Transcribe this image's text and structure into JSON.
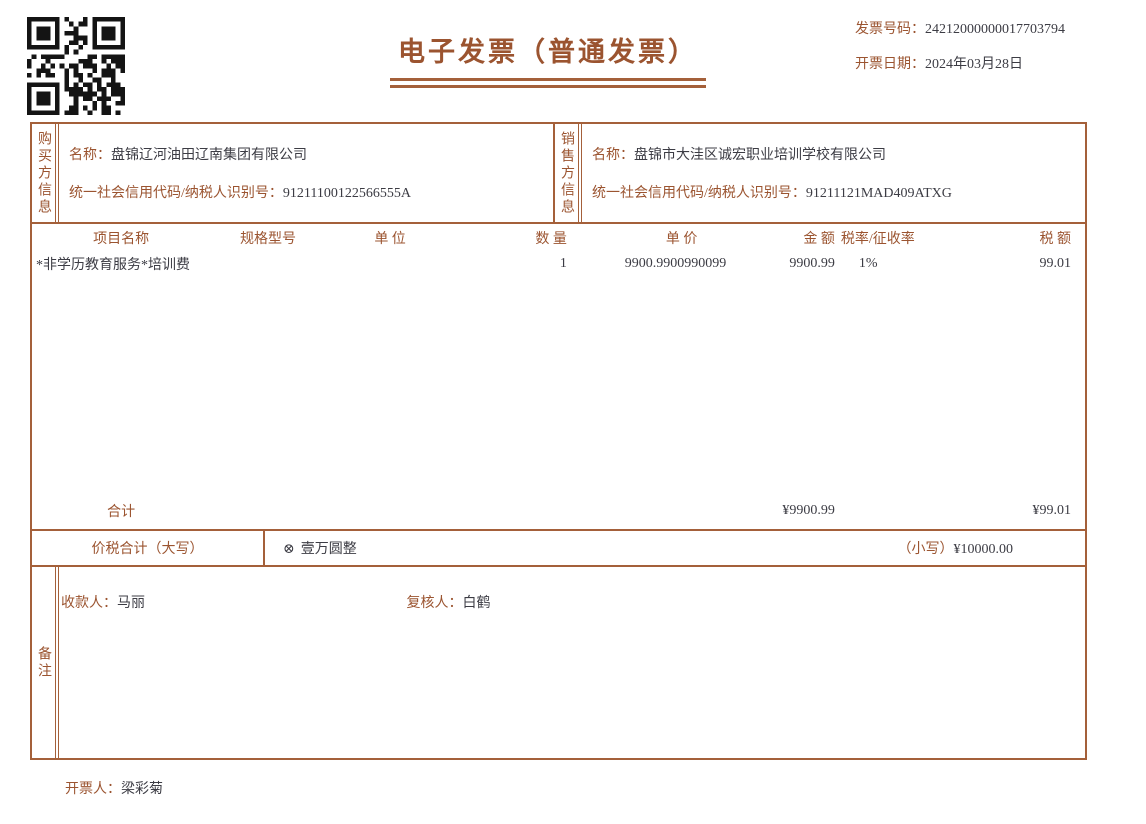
{
  "invoice": {
    "title": "电子发票（普通发票）",
    "number_label": "发票号码：",
    "number": "24212000000017703794",
    "date_label": "开票日期：",
    "date": "2024年03月28日"
  },
  "buyer": {
    "section_label": "购买方信息",
    "name_label": "名称：",
    "name": "盘锦辽河油田辽南集团有限公司",
    "tax_id_label": "统一社会信用代码/纳税人识别号：",
    "tax_id": "91211100122566555A"
  },
  "seller": {
    "section_label": "销售方信息",
    "name_label": "名称：",
    "name": "盘锦市大洼区诚宏职业培训学校有限公司",
    "tax_id_label": "统一社会信用代码/纳税人识别号：",
    "tax_id": "91211121MAD409ATXG"
  },
  "items_table": {
    "headers": [
      "项目名称",
      "规格型号",
      "单 位",
      "数 量",
      "单 价",
      "金 额",
      "税率/征收率",
      "税 额"
    ],
    "rows": [
      {
        "name": "*非学历教育服务*培训费",
        "spec": "",
        "unit": "",
        "qty": "1",
        "unit_price": "9900.9900990099",
        "amount": "9900.99",
        "tax_rate": "1%",
        "tax": "99.01"
      }
    ],
    "total_label": "合计",
    "total_amount": "¥9900.99",
    "total_tax": "¥99.01"
  },
  "summary": {
    "label": "价税合计（大写）",
    "words_symbol": "⊗",
    "amount_words": "壹万圆整",
    "figures_label": "（小写）",
    "amount_figures": "¥10000.00"
  },
  "remarks": {
    "section_label": "备注",
    "payee_label": "收款人：",
    "payee": "马丽",
    "reviewer_label": "复核人：",
    "reviewer": "白鹤"
  },
  "footer": {
    "drawer_label": "开票人：",
    "drawer": "梁彩菊"
  },
  "colors": {
    "accent": "#9b5430",
    "border": "#a4603a",
    "text": "#3c3c44",
    "qr": "#141414"
  }
}
